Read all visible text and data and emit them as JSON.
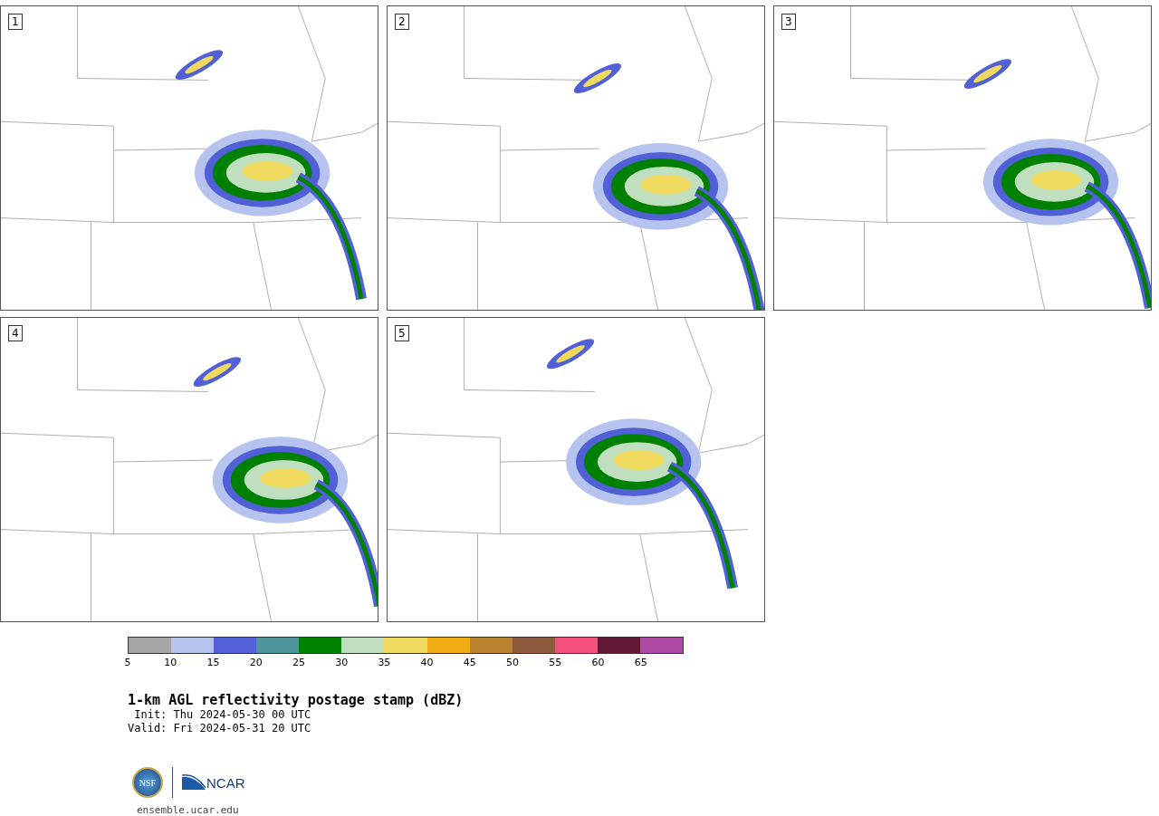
{
  "panels": [
    {
      "label": "1"
    },
    {
      "label": "2"
    },
    {
      "label": "3"
    },
    {
      "label": "4"
    },
    {
      "label": "5"
    }
  ],
  "colorbar": {
    "segments": [
      {
        "color": "#a5a5a5"
      },
      {
        "color": "#b6c3ef"
      },
      {
        "color": "#5160d6"
      },
      {
        "color": "#4e969b"
      },
      {
        "color": "#008000"
      },
      {
        "color": "#bfdfbf"
      },
      {
        "color": "#f0da5d"
      },
      {
        "color": "#f0ac14"
      },
      {
        "color": "#b9822f"
      },
      {
        "color": "#8b5a3f"
      },
      {
        "color": "#f54f7c"
      },
      {
        "color": "#611837"
      },
      {
        "color": "#ad4aa3"
      }
    ],
    "ticks": [
      "5",
      "10",
      "15",
      "20",
      "25",
      "30",
      "35",
      "40",
      "45",
      "50",
      "55",
      "60",
      "65"
    ]
  },
  "title": "1-km AGL reflectivity postage stamp (dBZ)",
  "init": " Init: Thu 2024-05-30 00 UTC",
  "valid": "Valid: Fri 2024-05-31 20 UTC",
  "logos": {
    "nsf": "NSF",
    "ncar": "NCAR"
  },
  "footer_link": "ensemble.ucar.edu"
}
